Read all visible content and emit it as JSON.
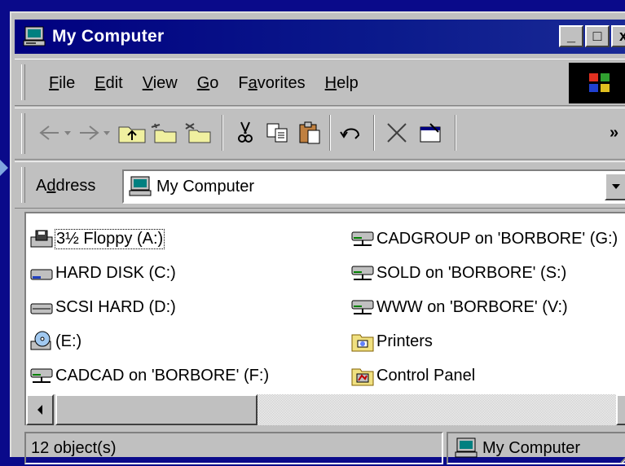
{
  "window": {
    "title": "My Computer",
    "controls": {
      "minimize": "_",
      "maximize": "□",
      "close": "x"
    }
  },
  "menu": {
    "items": [
      {
        "label": "File",
        "accel": "F",
        "rest": "ile"
      },
      {
        "label": "Edit",
        "accel": "E",
        "rest": "dit"
      },
      {
        "label": "View",
        "accel": "V",
        "rest": "iew"
      },
      {
        "label": "Go",
        "accel": "G",
        "rest": "o"
      },
      {
        "label": "Favorites",
        "pre": "F",
        "accel": "a",
        "rest": "vorites"
      },
      {
        "label": "Help",
        "accel": "H",
        "rest": "elp"
      }
    ]
  },
  "toolbar": {
    "chevron": "»",
    "buttons": [
      "back",
      "forward",
      "up",
      "map-drive",
      "disconnect",
      "cut",
      "copy",
      "paste",
      "undo",
      "delete",
      "properties"
    ]
  },
  "address": {
    "label_pre": "A",
    "label_accel": "d",
    "label_rest": "dress",
    "value": "My Computer"
  },
  "items_left": [
    {
      "label": "3½ Floppy (A:)",
      "icon": "floppy-drive-icon"
    },
    {
      "label": "HARD DISK (C:)",
      "icon": "hard-disk-icon"
    },
    {
      "label": "SCSI HARD (D:)",
      "icon": "hard-disk-icon"
    },
    {
      "label": "(E:)",
      "icon": "cd-drive-icon"
    },
    {
      "label": "CADCAD on 'BORBORE' (F:)",
      "icon": "network-drive-icon"
    }
  ],
  "items_right": [
    {
      "label": "CADGROUP on 'BORBORE' (G:)",
      "icon": "network-drive-icon"
    },
    {
      "label": "SOLD on 'BORBORE' (S:)",
      "icon": "network-drive-icon"
    },
    {
      "label": "WWW on 'BORBORE' (V:)",
      "icon": "network-drive-icon"
    },
    {
      "label": "Printers",
      "icon": "printers-folder-icon"
    },
    {
      "label": "Control Panel",
      "icon": "control-panel-folder-icon"
    }
  ],
  "status": {
    "count": "12 object(s)",
    "location": "My Computer"
  },
  "colors": {
    "titlebar": "#000080",
    "face": "#c0c0c0",
    "desktop": "#0a0a8a"
  }
}
